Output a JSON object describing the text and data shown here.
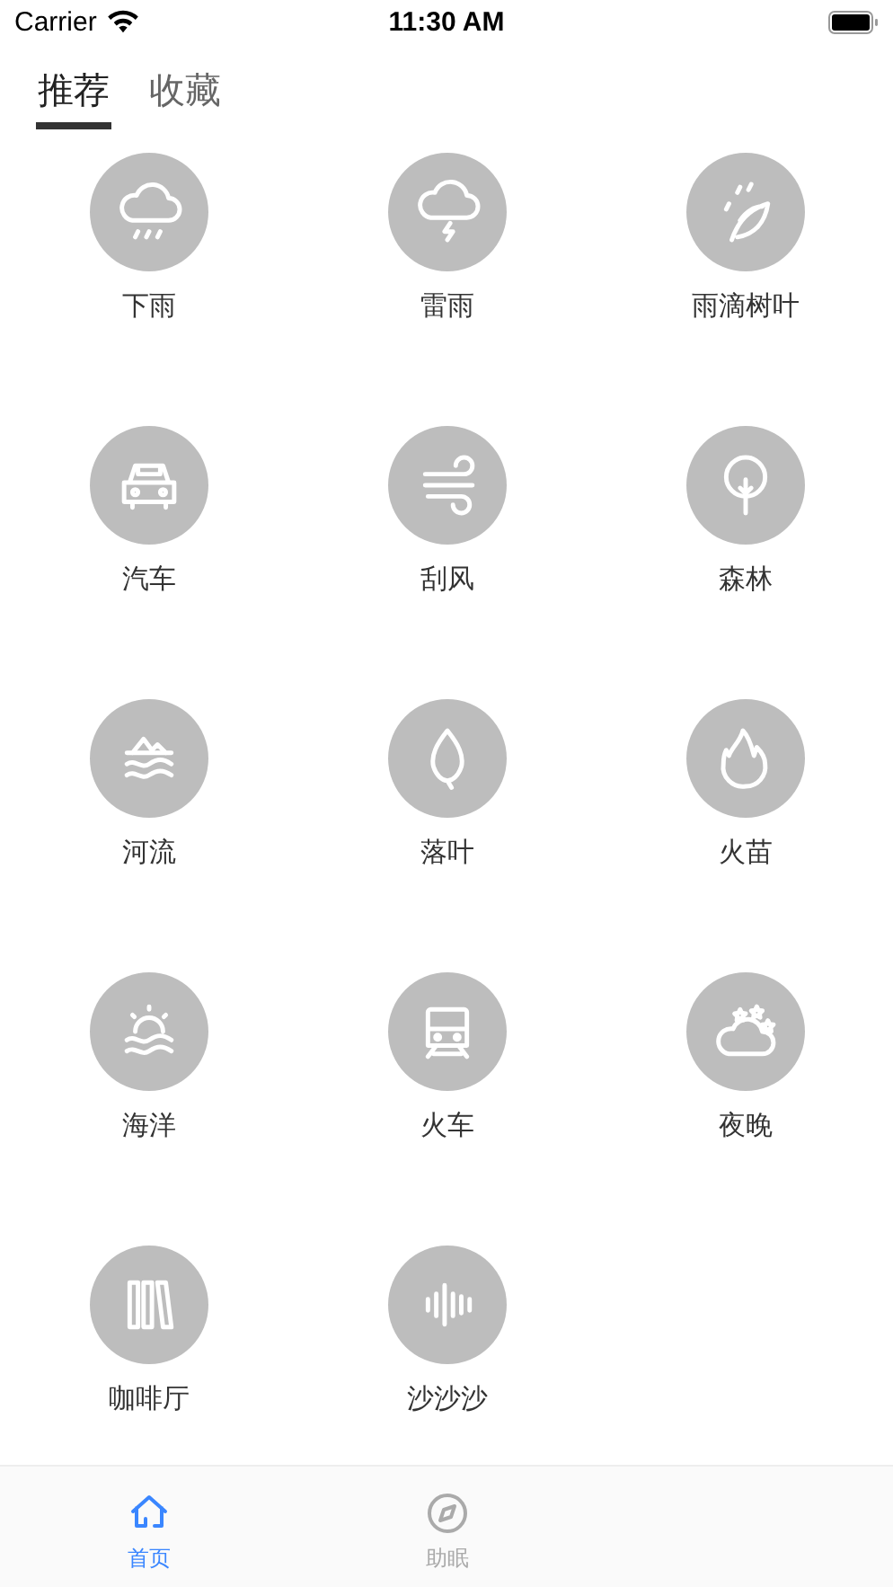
{
  "status_bar": {
    "carrier": "Carrier",
    "time": "11:30 AM"
  },
  "tabs": [
    {
      "label": "推荐",
      "selected": true
    },
    {
      "label": "收藏",
      "selected": false
    }
  ],
  "sounds": [
    {
      "label": "下雨"
    },
    {
      "label": "雷雨"
    },
    {
      "label": "雨滴树叶"
    },
    {
      "label": "汽车"
    },
    {
      "label": "刮风"
    },
    {
      "label": "森林"
    },
    {
      "label": "河流"
    },
    {
      "label": "落叶"
    },
    {
      "label": "火苗"
    },
    {
      "label": "海洋"
    },
    {
      "label": "火车"
    },
    {
      "label": "夜晚"
    },
    {
      "label": "咖啡厅"
    },
    {
      "label": "沙沙沙"
    }
  ],
  "tab_bar": [
    {
      "label": "首页",
      "selected": true
    },
    {
      "label": "助眠",
      "selected": false
    }
  ]
}
